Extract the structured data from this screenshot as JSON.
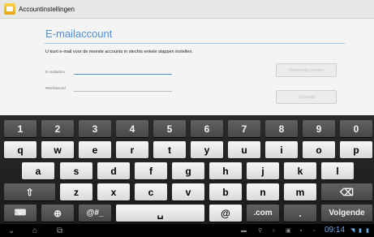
{
  "window": {
    "title": "Accountinstellingen"
  },
  "page": {
    "heading": "E-mailaccount",
    "intro": "U kunt e-mail voor de meeste accounts in slechts enkele stappen instellen.",
    "email_label": "E-mailadres",
    "password_label": "Wachtwoord",
    "email_value": "",
    "password_value": "",
    "manual_button": "Handmatig instellen",
    "next_button": "Volgende"
  },
  "keyboard": {
    "row1": [
      "1",
      "2",
      "3",
      "4",
      "5",
      "6",
      "7",
      "8",
      "9",
      "0"
    ],
    "row2": [
      "q",
      "w",
      "e",
      "r",
      "t",
      "y",
      "u",
      "i",
      "o",
      "p"
    ],
    "row3": [
      "a",
      "s",
      "d",
      "f",
      "g",
      "h",
      "j",
      "k",
      "l"
    ],
    "row4": [
      "z",
      "x",
      "c",
      "v",
      "b",
      "n",
      "m"
    ],
    "shift": "⇧",
    "backspace": "⌫",
    "kbd_settings": "⌨",
    "globe": "⊕",
    "symbols": "@#_",
    "space": "␣",
    "at": "@",
    "dotcom": ".com",
    "dot": ".",
    "enter": "Volgende"
  },
  "statusbar": {
    "time": "09:14"
  },
  "colors": {
    "accent": "#4f8fd0",
    "key_light": "#e8e8e8",
    "key_dark": "#555555",
    "keyboard_bg": "#222222"
  }
}
